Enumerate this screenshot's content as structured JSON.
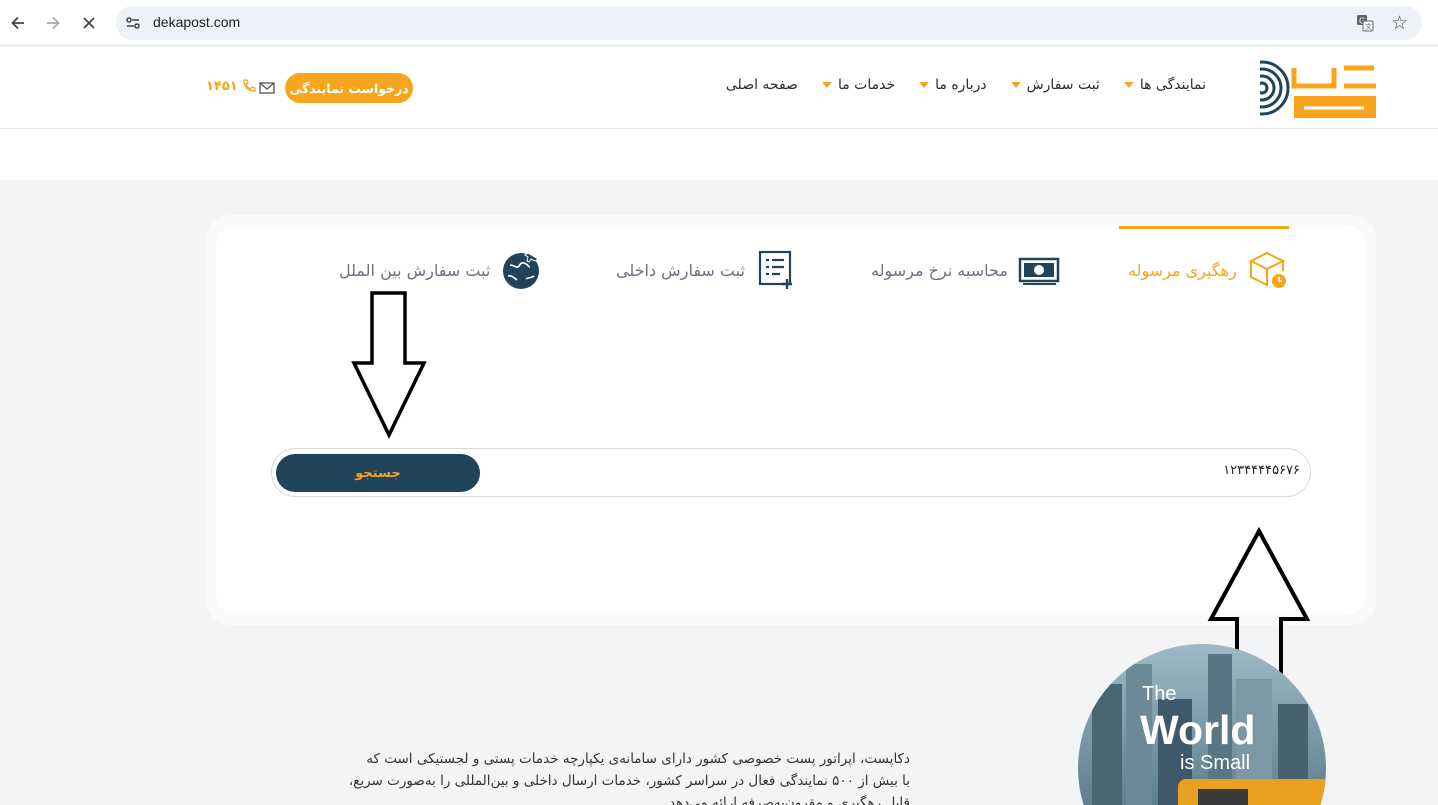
{
  "browser": {
    "url": "dekapost.com",
    "icons": [
      "back-icon",
      "forward-icon",
      "stop-icon",
      "site-info-icon",
      "translate-icon",
      "star-icon"
    ]
  },
  "header": {
    "menu": [
      {
        "label": "صفحه اصلی",
        "has_caret": false
      },
      {
        "label": "خدمات ما",
        "has_caret": true
      },
      {
        "label": "درباره ما",
        "has_caret": true
      },
      {
        "label": "ثبت سفارش",
        "has_caret": true
      },
      {
        "label": "نمایندگی ها",
        "has_caret": true
      }
    ],
    "request_button": "درخواست نمایندگی",
    "phone": "۱۴۵۱",
    "brand_color": "#f7a51c"
  },
  "tabs": [
    {
      "label": "رهگیری مرسوله",
      "active": true,
      "icon": "parcel-clock-icon"
    },
    {
      "label": "محاسبه نرخ مرسوله",
      "active": false,
      "icon": "money-icon"
    },
    {
      "label": "ثبت سفارش داخلی",
      "active": false,
      "icon": "list-add-icon"
    },
    {
      "label": "ثبت سفارش بین الملل",
      "active": false,
      "icon": "globe-plane-icon"
    }
  ],
  "search": {
    "value": "۱۲۳۴۴۴۴۵۶۷۶",
    "button": "جستجو",
    "button_color": "#21445b"
  },
  "about": {
    "lines": [
      "دکاپست، اپراتور پست خصوصی کشور دارای سامانه‌ی یکپارچه خدمات پستی و لجستیکی است که",
      "با بیش از ۵۰۰ نمایندگی فعال در سراسر کشور، خدمات ارسال داخلی و بین‌المللی را به‌صورت سریع،",
      "قابل رهگیری و مقرون‌به‌صرفه ارائه می‌دهد."
    ]
  },
  "promo": {
    "line1": "The",
    "line2": "World",
    "line3": "is Small"
  }
}
